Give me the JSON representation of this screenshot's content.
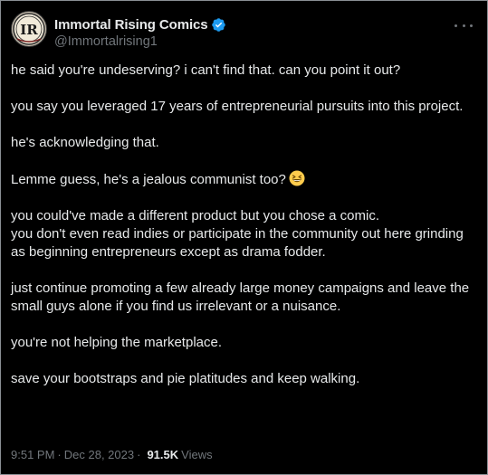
{
  "author": {
    "display_name": "Immortal Rising Comics",
    "handle": "@Immortalrising1",
    "avatar_monogram": "IR",
    "verified": true
  },
  "tweet": {
    "paragraphs": [
      "he said you're undeserving? i can't find that. can you point it out?",
      "you say you leveraged 17 years of entrepreneurial pursuits into this project.",
      "he's acknowledging that.",
      "Lemme guess, he's a jealous communist too?",
      "you could've made a different product but you chose a comic.\nyou don't even read indies or participate in the community out here grinding as beginning entrepreneurs except as drama fodder.",
      "just continue promoting a few already large money campaigns and leave the small guys alone if you find us irrelevant or a nuisance.",
      "you're not helping the marketplace.",
      "save your bootstraps and pie platitudes and keep walking."
    ],
    "emoji": "grinning-squinting-face"
  },
  "meta": {
    "time": "9:51 PM",
    "separator": "·",
    "date": "Dec 28, 2023",
    "views_count": "91.5K",
    "views_label": "Views"
  },
  "colors": {
    "background": "#000000",
    "text": "#e7e9ea",
    "muted": "#71767b",
    "verified": "#1d9bf0",
    "border": "#8a8f94"
  },
  "icons": {
    "more": "more-horizontal-icon",
    "verified": "verified-badge-icon"
  }
}
